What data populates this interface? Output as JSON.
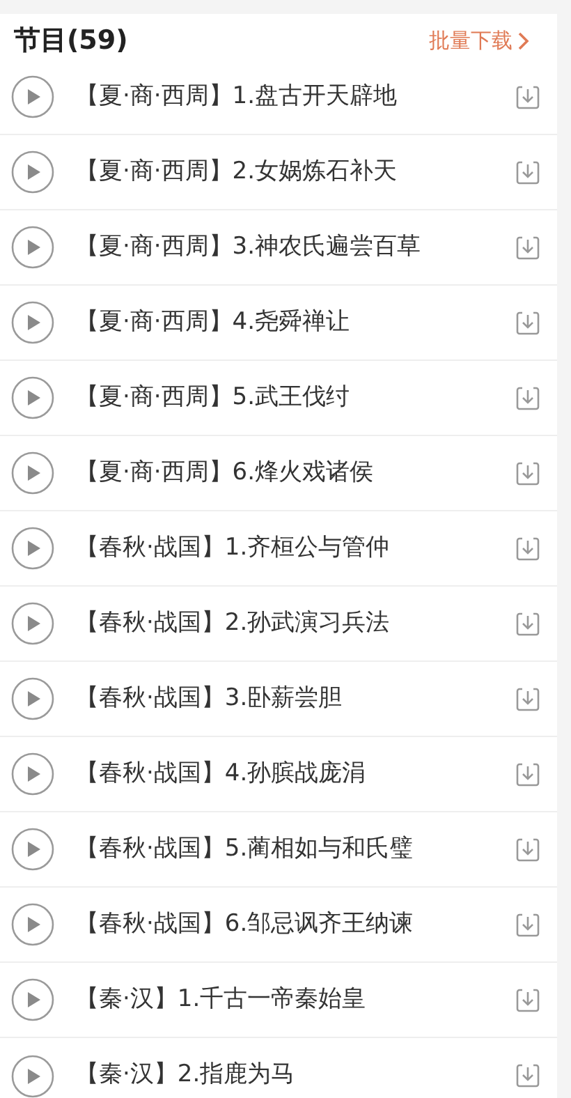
{
  "header": {
    "title": "节目(59)",
    "batch_download": "批量下载"
  },
  "episodes": [
    {
      "title": "【夏·商·西周】1.盘古开天辟地"
    },
    {
      "title": "【夏·商·西周】2.女娲炼石补天"
    },
    {
      "title": "【夏·商·西周】3.神农氏遍尝百草"
    },
    {
      "title": "【夏·商·西周】4.尧舜禅让"
    },
    {
      "title": "【夏·商·西周】5.武王伐纣"
    },
    {
      "title": "【夏·商·西周】6.烽火戏诸侯"
    },
    {
      "title": "【春秋·战国】1.齐桓公与管仲"
    },
    {
      "title": "【春秋·战国】2.孙武演习兵法"
    },
    {
      "title": "【春秋·战国】3.卧薪尝胆"
    },
    {
      "title": "【春秋·战国】4.孙膑战庞涓"
    },
    {
      "title": "【春秋·战国】5.蔺相如与和氏璧"
    },
    {
      "title": "【春秋·战国】6.邹忌讽齐王纳谏"
    },
    {
      "title": "【秦·汉】1.千古一帝秦始皇"
    },
    {
      "title": "【秦·汉】2.指鹿为马"
    }
  ]
}
